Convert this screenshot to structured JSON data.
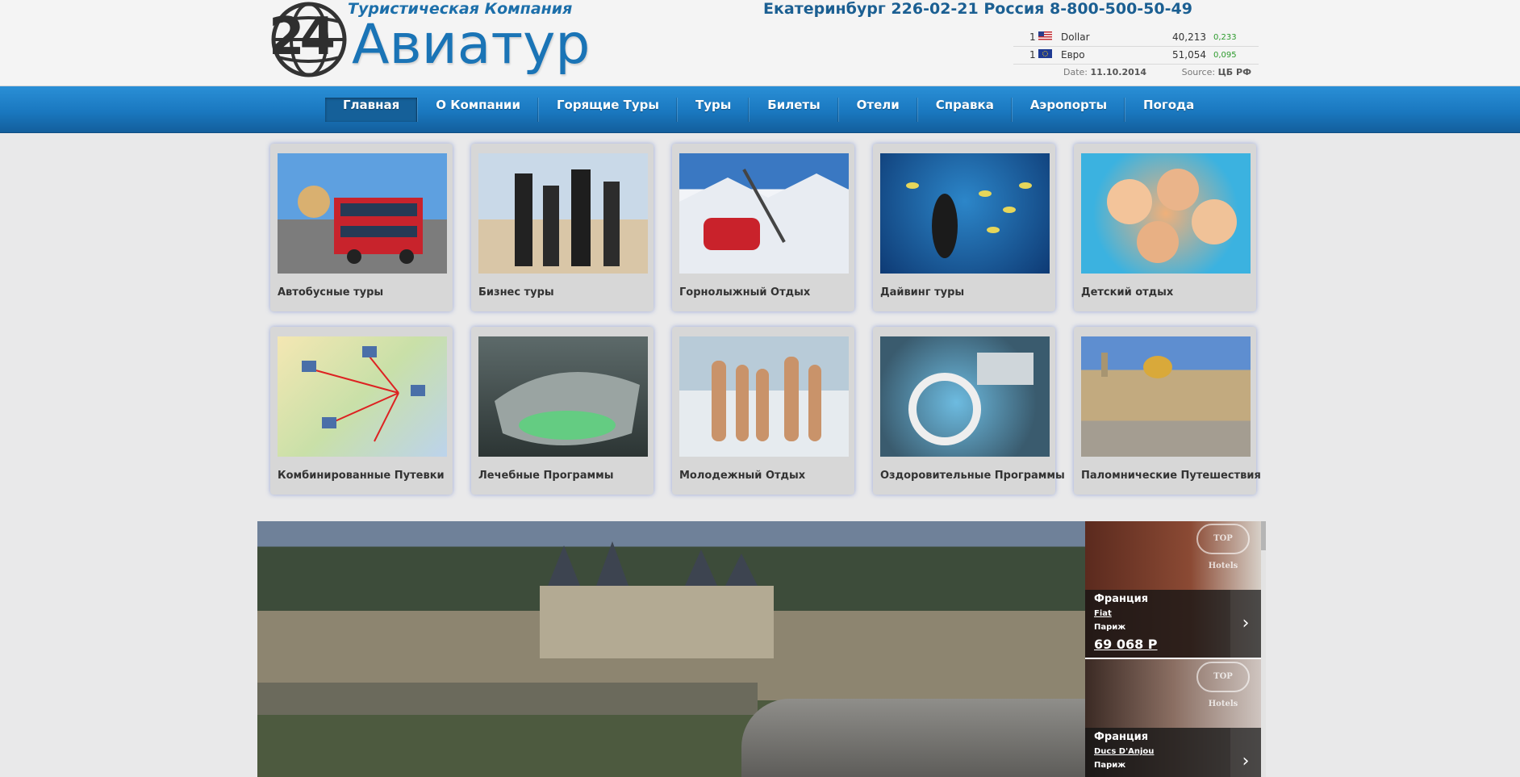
{
  "header": {
    "tagline": "Туристическая Компания",
    "logo_number": "24",
    "logo_name": "Авиатур",
    "phones": "Екатеринбург 226-02-21 Россия 8-800-500-50-49",
    "rates": [
      {
        "amount": "1",
        "flag_icon": "us-flag-icon",
        "currency": "Dollar",
        "value": "40,213",
        "change": "0,233"
      },
      {
        "amount": "1",
        "flag_icon": "eu-flag-icon",
        "currency": "Евро",
        "value": "51,054",
        "change": "0,095"
      }
    ],
    "date_label": "Date:",
    "date_value": "11.10.2014",
    "source_label": "Source:",
    "source_value": "ЦБ РФ"
  },
  "nav": {
    "items": [
      {
        "label": "Главная",
        "active": true
      },
      {
        "label": "О Компании"
      },
      {
        "label": "Горящие Туры"
      },
      {
        "label": "Туры"
      },
      {
        "label": "Билеты"
      },
      {
        "label": "Отели"
      },
      {
        "label": "Справка"
      },
      {
        "label": "Аэропорты"
      },
      {
        "label": "Погода"
      }
    ]
  },
  "categories": [
    {
      "label": "Автобусные туры"
    },
    {
      "label": "Бизнес туры"
    },
    {
      "label": "Горнолыжный Отдых"
    },
    {
      "label": "Дайвинг туры"
    },
    {
      "label": "Детский отдых"
    },
    {
      "label": "Комбинированные Путевки"
    },
    {
      "label": "Лечебные Программы"
    },
    {
      "label": "Молодежный Отдых"
    },
    {
      "label": "Оздоровительные Программы"
    },
    {
      "label": "Паломнические Путешествия"
    }
  ],
  "hotels": [
    {
      "country": "Франция",
      "name": "Fiat",
      "city": "Париж",
      "price": "69 068 Р",
      "badge": "TOP Hotels"
    },
    {
      "country": "Франция",
      "name": "Ducs D'Anjou",
      "city": "Париж",
      "badge": "TOP Hotels"
    }
  ],
  "colors": {
    "nav": "#1a78c0",
    "brand": "#1a74b6",
    "price_change": "#2b9a2b"
  }
}
